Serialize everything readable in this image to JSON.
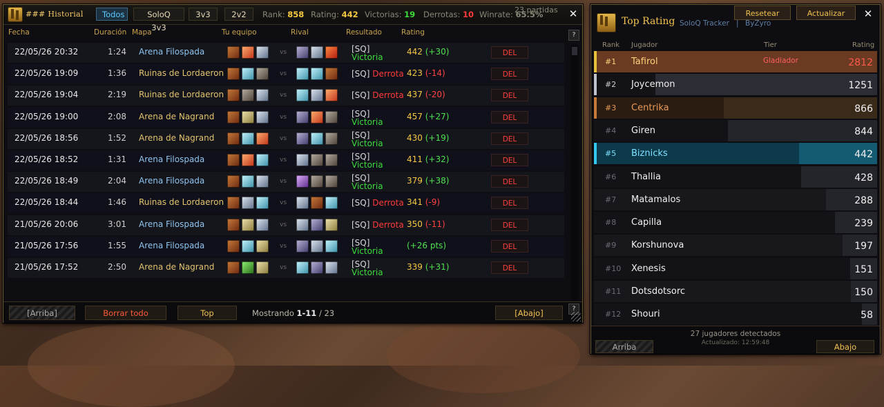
{
  "colors": {
    "accent_gold": "#f2c24e",
    "win": "#3ddc3d",
    "loss": "#ff3b3b",
    "active_filter": "#5cc9ff"
  },
  "historial": {
    "title": "### Historial",
    "filters": [
      "Todos",
      "SoloQ 3v3",
      "3v3",
      "2v2"
    ],
    "active_filter": "Todos",
    "stats": {
      "rank_label": "Rank:",
      "rank": "858",
      "rating_label": "Rating:",
      "rating": "442",
      "victorias_label": "Victorias:",
      "victorias": "19",
      "derrotas_label": "Derrotas:",
      "derrotas": "10",
      "winrate_label": "Winrate:",
      "winrate": "65.5%",
      "partidas": "23 partidas"
    },
    "columns": [
      "Fecha",
      "Duración",
      "Mapa",
      "Tu equipo",
      "Rival",
      "Resultado",
      "Rating"
    ],
    "vs": "vs",
    "del_label": "DEL",
    "help": "?",
    "rows": [
      {
        "fecha": "22/05/26 20:32",
        "dur": "1:24",
        "mapa": "Arena Filospada",
        "map_color": "blue",
        "team": [
          "hunter",
          "mage",
          "warrior"
        ],
        "rival": [
          "priest",
          "warrior",
          "fire"
        ],
        "tag": "[SQ]",
        "result": "Victoria",
        "rating": "442",
        "delta": "(+30)"
      },
      {
        "fecha": "22/05/26 19:09",
        "dur": "1:36",
        "mapa": "Ruinas de Lordaeron",
        "map_color": "gold",
        "team": [
          "hunter",
          "rogue",
          "druid"
        ],
        "rival": [
          "rogue",
          "rogue",
          "hunter"
        ],
        "tag": "[SQ]",
        "result": "Derrota",
        "rating": "423",
        "delta": "(-14)"
      },
      {
        "fecha": "22/05/26 19:04",
        "dur": "2:19",
        "mapa": "Ruinas de Lordaeron",
        "map_color": "gold",
        "team": [
          "hunter",
          "druid",
          "warrior"
        ],
        "rival": [
          "rogue",
          "warrior",
          "mage"
        ],
        "tag": "[SQ]",
        "result": "Derrota",
        "rating": "437",
        "delta": "(-20)"
      },
      {
        "fecha": "22/05/26 19:00",
        "dur": "2:08",
        "mapa": "Arena de Nagrand",
        "map_color": "gold",
        "team": [
          "hunter",
          "paladin",
          "warrior"
        ],
        "rival": [
          "priest",
          "mage",
          "druid"
        ],
        "tag": "[SQ]",
        "result": "Victoria",
        "rating": "457",
        "delta": "(+27)"
      },
      {
        "fecha": "22/05/26 18:56",
        "dur": "1:52",
        "mapa": "Arena de Nagrand",
        "map_color": "gold",
        "team": [
          "hunter",
          "rogue",
          "mage"
        ],
        "rival": [
          "priest",
          "rogue",
          "druid"
        ],
        "tag": "[SQ]",
        "result": "Victoria",
        "rating": "430",
        "delta": "(+19)"
      },
      {
        "fecha": "22/05/26 18:52",
        "dur": "1:31",
        "mapa": "Arena Filospada",
        "map_color": "blue",
        "team": [
          "hunter",
          "mage",
          "rogue"
        ],
        "rival": [
          "warrior",
          "druid",
          "druid"
        ],
        "tag": "[SQ]",
        "result": "Victoria",
        "rating": "411",
        "delta": "(+32)"
      },
      {
        "fecha": "22/05/26 18:49",
        "dur": "2:04",
        "mapa": "Arena Filospada",
        "map_color": "blue",
        "team": [
          "hunter",
          "rogue",
          "warrior"
        ],
        "rival": [
          "warlock",
          "druid",
          "druid"
        ],
        "tag": "[SQ]",
        "result": "Victoria",
        "rating": "379",
        "delta": "(+38)"
      },
      {
        "fecha": "22/05/26 18:44",
        "dur": "1:46",
        "mapa": "Ruinas de Lordaeron",
        "map_color": "gold",
        "team": [
          "hunter",
          "warrior",
          "rogue"
        ],
        "rival": [
          "warrior",
          "hunter",
          "rogue"
        ],
        "tag": "[SQ]",
        "result": "Derrota",
        "rating": "341",
        "delta": "(-9)"
      },
      {
        "fecha": "21/05/26 20:06",
        "dur": "3:01",
        "mapa": "Arena Filospada",
        "map_color": "blue",
        "team": [
          "hunter",
          "paladin",
          "warrior"
        ],
        "rival": [
          "warrior",
          "priest",
          "paladin"
        ],
        "tag": "[SQ]",
        "result": "Derrota",
        "rating": "350",
        "delta": "(-11)"
      },
      {
        "fecha": "21/05/26 17:56",
        "dur": "1:55",
        "mapa": "Arena Filospada",
        "map_color": "blue",
        "team": [
          "hunter",
          "rogue",
          "paladin"
        ],
        "rival": [
          "priest",
          "warrior",
          "rogue"
        ],
        "tag": "[SQ]",
        "result": "Victoria",
        "rating": "",
        "delta": "(+26 pts)"
      },
      {
        "fecha": "21/05/26 17:52",
        "dur": "2:50",
        "mapa": "Arena de Nagrand",
        "map_color": "gold",
        "team": [
          "hunter",
          "shaman",
          "paladin"
        ],
        "rival": [
          "rogue",
          "priest",
          "warrior"
        ],
        "tag": "[SQ]",
        "result": "Victoria",
        "rating": "339",
        "delta": "(+31)"
      }
    ],
    "footer": {
      "arriba": "[Arriba]",
      "borrar": "Borrar todo",
      "top": "Top",
      "mostrando_label": "Mostrando",
      "mostrando_range": "1-11",
      "mostrando_total": "/ 23",
      "abajo": "[Abajo]"
    }
  },
  "top": {
    "title": "Top Rating",
    "subtitle_a": "SoloQ Tracker",
    "subtitle_sep": "|",
    "subtitle_b": "ByZyro",
    "btn_reset": "Resetear",
    "btn_update": "Actualizar",
    "columns": [
      "Rank",
      "Jugador",
      "Tier",
      "Rating"
    ],
    "players": [
      {
        "rank": "#1",
        "name": "Tafirol",
        "tier": "Gladiador",
        "rating": "2812",
        "style": "gold"
      },
      {
        "rank": "#2",
        "name": "Joycemon",
        "tier": "",
        "rating": "1251",
        "style": "silver"
      },
      {
        "rank": "#3",
        "name": "Centrika",
        "tier": "",
        "rating": "866",
        "style": "bronze"
      },
      {
        "rank": "#4",
        "name": "Giren",
        "tier": "",
        "rating": "844",
        "style": "plain"
      },
      {
        "rank": "#5",
        "name": "Biznicks",
        "tier": "",
        "rating": "442",
        "style": "self"
      },
      {
        "rank": "#6",
        "name": "Thallia",
        "tier": "",
        "rating": "428",
        "style": "plain"
      },
      {
        "rank": "#7",
        "name": "Matamalos",
        "tier": "",
        "rating": "288",
        "style": "plain"
      },
      {
        "rank": "#8",
        "name": "Capilla",
        "tier": "",
        "rating": "239",
        "style": "plain"
      },
      {
        "rank": "#9",
        "name": "Korshunova",
        "tier": "",
        "rating": "197",
        "style": "plain"
      },
      {
        "rank": "#10",
        "name": "Xenesis",
        "tier": "",
        "rating": "151",
        "style": "plain"
      },
      {
        "rank": "#11",
        "name": "Dotsdotsorc",
        "tier": "",
        "rating": "150",
        "style": "plain"
      },
      {
        "rank": "#12",
        "name": "Shouri",
        "tier": "",
        "rating": "58",
        "style": "plain"
      }
    ],
    "footer": {
      "detected": "27 jugadores detectados",
      "updated": "Actualizado: 12:59:48",
      "arriba": "Arriba",
      "abajo": "Abajo"
    }
  }
}
